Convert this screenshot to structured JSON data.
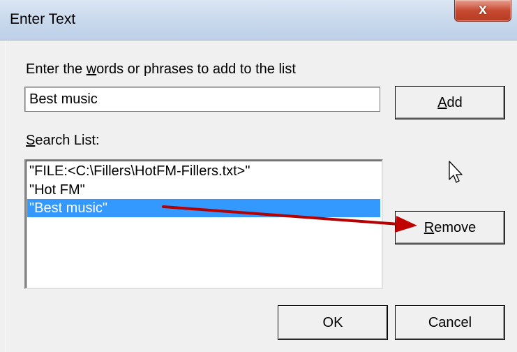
{
  "window": {
    "title": "Enter Text",
    "close_glyph": "x"
  },
  "prompt": {
    "pre": "Enter the ",
    "mnemonic": "w",
    "post": "ords or phrases to add to the list"
  },
  "input": {
    "value": "Best music"
  },
  "buttons": {
    "add": {
      "mnemonic": "A",
      "rest": "dd"
    },
    "remove": {
      "mnemonic": "R",
      "rest": "emove"
    },
    "ok": "OK",
    "cancel": "Cancel"
  },
  "search_list": {
    "label_mnemonic": "S",
    "label_rest": "earch List:",
    "items": [
      "\"FILE:<C:\\Fillers\\HotFM-Fillers.txt>\"",
      "\"Hot FM\"",
      "\"Best music\""
    ],
    "selected_index": 2
  },
  "colors": {
    "selection": "#3399ff",
    "annotation_arrow": "#c00000",
    "close_button": "#c74b33"
  }
}
